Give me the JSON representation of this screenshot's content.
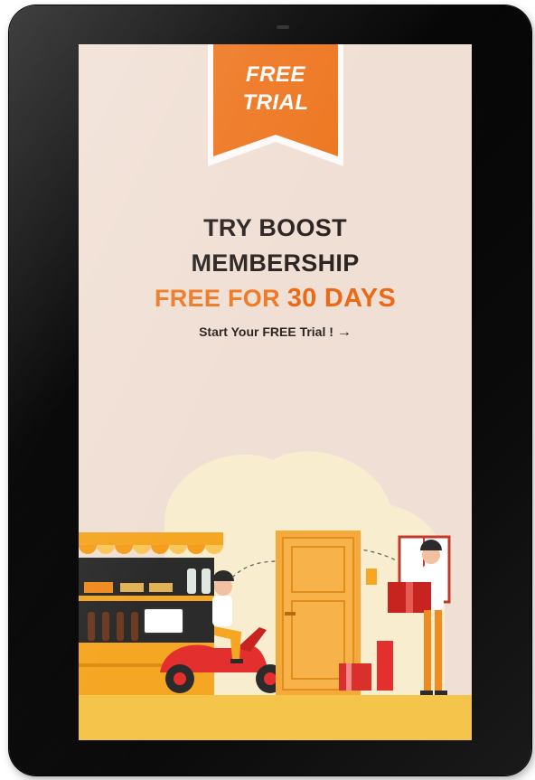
{
  "ribbon": {
    "line1": "FREE",
    "line2": "TRIAL"
  },
  "headline": {
    "line1": "TRY BOOST",
    "line2": "MEMBERSHIP",
    "line3_prefix": "FREE FOR ",
    "line3_emphasis": "30 DAYS"
  },
  "cta": {
    "label": "Start Your FREE Trial !",
    "arrow": "→"
  },
  "colors": {
    "accent": "#ef7a25",
    "accent_dark": "#ea6a17",
    "screen_bg": "#f0dfd4",
    "text_dark": "#2c2523",
    "scooter_red": "#e3302e",
    "door_orange": "#f4a93a",
    "floor_yellow": "#f5c44a"
  },
  "icons": [
    "arrow-right-icon"
  ]
}
